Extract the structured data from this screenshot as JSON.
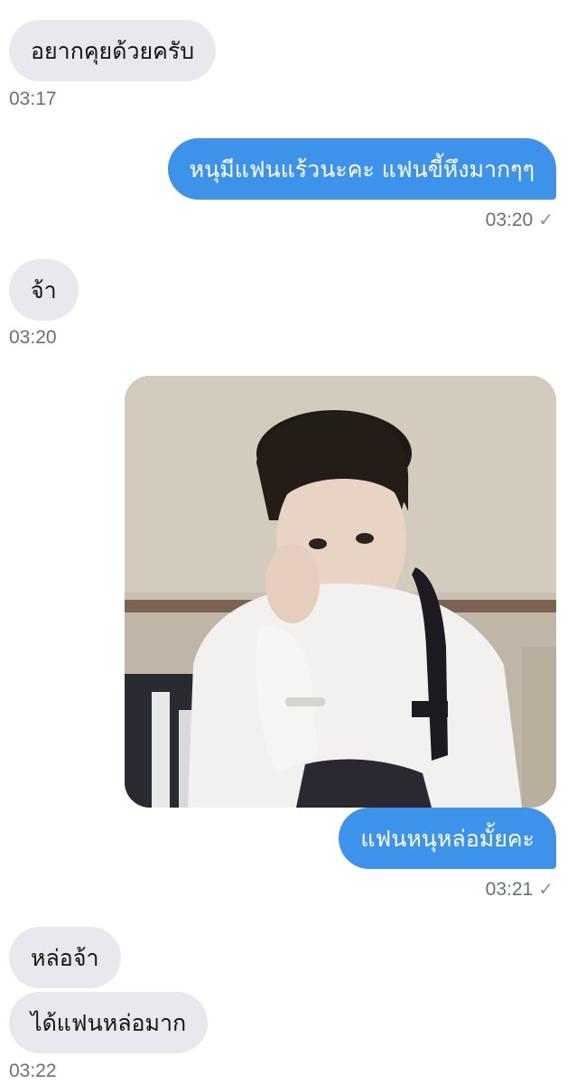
{
  "messages": [
    {
      "text": "อยากคุยด้วยครับ",
      "time": "03:17"
    },
    {
      "text": "หนุมีแฟนแร้วนะคะ แฟนขี้หึงมากๆๆ",
      "time": "03:20",
      "status": "✓"
    },
    {
      "text": "จ้า",
      "time": "03:20"
    },
    {
      "caption": "แฟนหนุหล่อมั้ยคะ",
      "time": "03:21",
      "status": "✓"
    },
    {
      "text": "หล่อจ้า"
    },
    {
      "text": "ได้แฟนหล่อมาก",
      "time": "03:22"
    }
  ]
}
